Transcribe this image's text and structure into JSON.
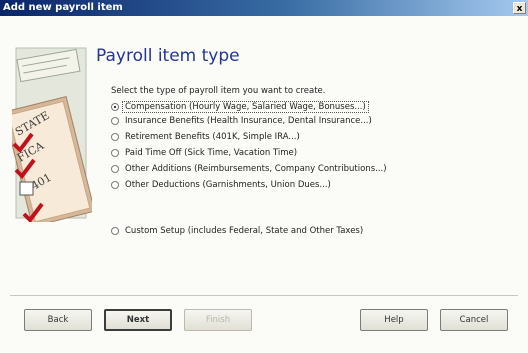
{
  "window": {
    "title": "Add new payroll item",
    "close_glyph": "x"
  },
  "illustration": {
    "icon": "tax-forms-checklist",
    "checks": [
      "STATE",
      "FICA",
      "401",
      ""
    ]
  },
  "main": {
    "heading": "Payroll item type",
    "prompt": "Select the type of payroll item you want to create.",
    "options": [
      {
        "label": "Compensation (Hourly Wage, Salaried Wage, Bonuses...)",
        "selected": true
      },
      {
        "label": "Insurance Benefits (Health Insurance, Dental Insurance...)",
        "selected": false
      },
      {
        "label": "Retirement Benefits (401K, Simple IRA...)",
        "selected": false
      },
      {
        "label": "Paid Time Off (Sick Time, Vacation Time)",
        "selected": false
      },
      {
        "label": "Other Additions (Reimbursements, Company Contributions...)",
        "selected": false
      },
      {
        "label": "Other Deductions (Garnishments, Union Dues...)",
        "selected": false
      },
      {
        "label": "Custom Setup (includes Federal, State and Other Taxes)",
        "selected": false
      }
    ]
  },
  "buttons": {
    "back": "Back",
    "next": "Next",
    "finish": "Finish",
    "help": "Help",
    "cancel": "Cancel"
  }
}
